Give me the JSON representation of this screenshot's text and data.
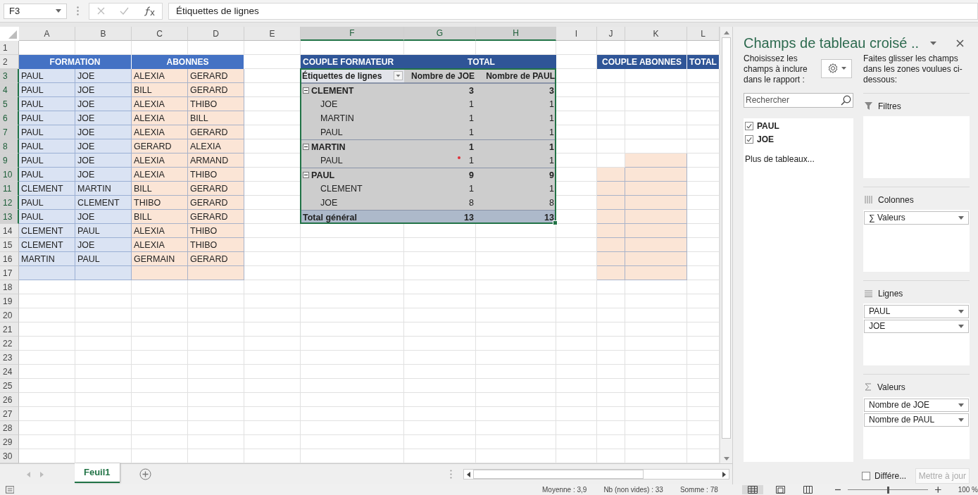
{
  "formula_bar": {
    "name_box": "F3",
    "formula": "Étiquettes de lignes"
  },
  "columns": [
    {
      "label": "A",
      "selected": false
    },
    {
      "label": "B",
      "selected": false
    },
    {
      "label": "C",
      "selected": false
    },
    {
      "label": "D",
      "selected": false
    },
    {
      "label": "E",
      "selected": false
    },
    {
      "label": "F",
      "selected": true
    },
    {
      "label": "G",
      "selected": true
    },
    {
      "label": "H",
      "selected": true
    },
    {
      "label": "I",
      "selected": false
    },
    {
      "label": "J",
      "selected": false
    },
    {
      "label": "K",
      "selected": false
    },
    {
      "label": "L",
      "selected": false
    }
  ],
  "rows": [
    {
      "label": "1",
      "selected": false
    },
    {
      "label": "2",
      "selected": false
    },
    {
      "label": "3",
      "selected": true
    },
    {
      "label": "4",
      "selected": true
    },
    {
      "label": "5",
      "selected": true
    },
    {
      "label": "6",
      "selected": true
    },
    {
      "label": "7",
      "selected": true
    },
    {
      "label": "8",
      "selected": true
    },
    {
      "label": "9",
      "selected": true
    },
    {
      "label": "10",
      "selected": true
    },
    {
      "label": "11",
      "selected": true
    },
    {
      "label": "12",
      "selected": true
    },
    {
      "label": "13",
      "selected": true
    },
    {
      "label": "14",
      "selected": false
    },
    {
      "label": "15",
      "selected": false
    },
    {
      "label": "16",
      "selected": false
    },
    {
      "label": "17",
      "selected": false
    },
    {
      "label": "18",
      "selected": false
    },
    {
      "label": "19",
      "selected": false
    },
    {
      "label": "20",
      "selected": false
    },
    {
      "label": "21",
      "selected": false
    },
    {
      "label": "22",
      "selected": false
    },
    {
      "label": "23",
      "selected": false
    },
    {
      "label": "24",
      "selected": false
    },
    {
      "label": "25",
      "selected": false
    },
    {
      "label": "26",
      "selected": false
    },
    {
      "label": "27",
      "selected": false
    },
    {
      "label": "28",
      "selected": false
    },
    {
      "label": "29",
      "selected": false
    },
    {
      "label": "30",
      "selected": false
    }
  ],
  "source_table": {
    "headers": [
      "FORMATION",
      "ABONNES"
    ],
    "rows": [
      [
        "PAUL",
        "JOE",
        "ALEXIA",
        "GERARD"
      ],
      [
        "PAUL",
        "JOE",
        "BILL",
        "GERARD"
      ],
      [
        "PAUL",
        "JOE",
        "ALEXIA",
        "THIBO"
      ],
      [
        "PAUL",
        "JOE",
        "ALEXIA",
        "BILL"
      ],
      [
        "PAUL",
        "JOE",
        "ALEXIA",
        "GERARD"
      ],
      [
        "PAUL",
        "JOE",
        "GERARD",
        "ALEXIA"
      ],
      [
        "PAUL",
        "JOE",
        "ALEXIA",
        "ARMAND"
      ],
      [
        "PAUL",
        "JOE",
        "ALEXIA",
        "THIBO"
      ],
      [
        "CLEMENT",
        "MARTIN",
        "BILL",
        "GERARD"
      ],
      [
        "PAUL",
        "CLEMENT",
        "THIBO",
        "GERARD"
      ],
      [
        "PAUL",
        "JOE",
        "BILL",
        "GERARD"
      ],
      [
        "CLEMENT",
        "PAUL",
        "ALEXIA",
        "THIBO"
      ],
      [
        "CLEMENT",
        "JOE",
        "ALEXIA",
        "THIBO"
      ],
      [
        "MARTIN",
        "PAUL",
        "GERMAIN",
        "GERARD"
      ]
    ]
  },
  "pivot_table": {
    "header": [
      "COUPLE FORMATEUR",
      "TOTAL"
    ],
    "columns": [
      "Étiquettes de lignes",
      "Nombre de JOE",
      "Nombre de PAUL"
    ],
    "groups": [
      {
        "label": "CLEMENT",
        "expanded": true,
        "values": [
          "3",
          "3"
        ],
        "children": [
          {
            "label": "JOE",
            "values": [
              "1",
              "1"
            ],
            "marked": false
          },
          {
            "label": "MARTIN",
            "values": [
              "1",
              "1"
            ],
            "marked": false
          },
          {
            "label": "PAUL",
            "values": [
              "1",
              "1"
            ],
            "marked": false
          }
        ]
      },
      {
        "label": "MARTIN",
        "expanded": true,
        "values": [
          "1",
          "1"
        ],
        "children": [
          {
            "label": "PAUL",
            "values": [
              "1",
              "1"
            ],
            "marked": true
          }
        ]
      },
      {
        "label": "PAUL",
        "expanded": true,
        "values": [
          "9",
          "9"
        ],
        "children": [
          {
            "label": "CLEMENT",
            "values": [
              "1",
              "1"
            ],
            "marked": false
          },
          {
            "label": "JOE",
            "values": [
              "8",
              "8"
            ],
            "marked": false
          }
        ]
      }
    ],
    "total": {
      "label": "Total général",
      "values": [
        "13",
        "13"
      ]
    }
  },
  "second_table": {
    "header": [
      "COUPLE ABONNES",
      "TOTAL"
    ]
  },
  "sheet_tabs": [
    {
      "label": "Feuil1",
      "selected": true
    }
  ],
  "field_panel": {
    "title": "Champs de tableau croisé ..",
    "intro": "Choisissez les champs à inclure dans le rapport :",
    "search_placeholder": "Rechercher",
    "fields": [
      {
        "label": "PAUL",
        "checked": true
      },
      {
        "label": "JOE",
        "checked": true
      }
    ],
    "more_tables": "Plus de tableaux...",
    "drag_hint": "Faites glisser les champs dans les zones voulues ci-dessous:",
    "areas": [
      {
        "kind": "filters",
        "label": "Filtres"
      },
      {
        "kind": "columns",
        "label": "Colonnes",
        "items": [
          "∑ Valeurs"
        ]
      },
      {
        "kind": "rows",
        "label": "Lignes",
        "items": [
          "PAUL",
          "JOE"
        ]
      },
      {
        "kind": "values",
        "label": "Valeurs",
        "items": [
          "Nombre de JOE",
          "Nombre de PAUL"
        ]
      }
    ],
    "defer": {
      "label": "Différe...",
      "checked": false
    },
    "update_button": {
      "label": "Mettre à jour",
      "disabled": true
    }
  },
  "status_bar": {
    "average": "Moyenne : 3,9",
    "count": "Nb (non vides) : 33",
    "sum": "Somme : 78",
    "zoom": {
      "level": 0.5,
      "reading": "100 %"
    }
  }
}
